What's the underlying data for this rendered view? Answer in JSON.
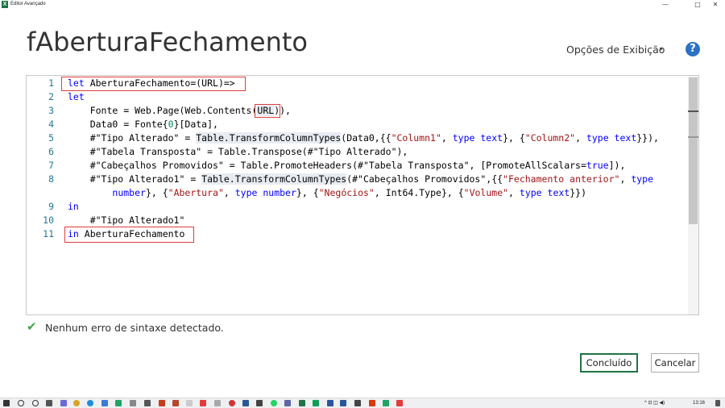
{
  "window": {
    "title": "Editor Avançado",
    "app_icon": "X",
    "controls": {
      "minimize": "—",
      "maximize": "□",
      "close": "✕"
    }
  },
  "query": {
    "name": "fAberturaFechamento"
  },
  "header": {
    "options_label": "Opções de Exibição",
    "options_arrow": "▾",
    "help_icon": "?"
  },
  "editor": {
    "line_numbers": [
      "1",
      "2",
      "3",
      "4",
      "5",
      "6",
      "7",
      "8",
      "",
      "9",
      "10",
      "11"
    ],
    "lines": [
      [
        {
          "t": "let ",
          "c": "kw"
        },
        {
          "t": "AberturaFechamento=(URL)=>",
          "c": ""
        }
      ],
      [
        {
          "t": "let",
          "c": "kw"
        }
      ],
      [
        {
          "t": "    Fonte = Web.Page(Web.Contents(",
          "c": ""
        },
        {
          "t": "URL",
          "c": "ref"
        },
        {
          "t": ")),",
          "c": ""
        }
      ],
      [
        {
          "t": "    Data0 = Fonte{",
          "c": ""
        },
        {
          "t": "0",
          "c": "num"
        },
        {
          "t": "}[Data],",
          "c": ""
        }
      ],
      [
        {
          "t": "    #\"Tipo Alterado\" = ",
          "c": ""
        },
        {
          "t": "Table.TransformColumnTypes",
          "c": "ref"
        },
        {
          "t": "(Data0,{{",
          "c": ""
        },
        {
          "t": "\"Column1\"",
          "c": "str"
        },
        {
          "t": ", ",
          "c": ""
        },
        {
          "t": "type text",
          "c": "kw"
        },
        {
          "t": "}, {",
          "c": ""
        },
        {
          "t": "\"Column2\"",
          "c": "str"
        },
        {
          "t": ", ",
          "c": ""
        },
        {
          "t": "type text",
          "c": "kw"
        },
        {
          "t": "}}),",
          "c": ""
        }
      ],
      [
        {
          "t": "    #\"Tabela Transposta\" = Table.Transpose(#\"Tipo Alterado\"),",
          "c": ""
        }
      ],
      [
        {
          "t": "    #\"Cabeçalhos Promovidos\" = Table.PromoteHeaders(#\"Tabela Transposta\", [PromoteAllScalars=",
          "c": ""
        },
        {
          "t": "true",
          "c": "kw"
        },
        {
          "t": "]),",
          "c": ""
        }
      ],
      [
        {
          "t": "    #\"Tipo Alterado1\" = ",
          "c": ""
        },
        {
          "t": "Table.TransformColumnTypes",
          "c": "ref"
        },
        {
          "t": "(#\"Cabeçalhos Promovidos\",{{",
          "c": ""
        },
        {
          "t": "\"Fechamento anterior\"",
          "c": "str"
        },
        {
          "t": ", ",
          "c": ""
        },
        {
          "t": "type",
          "c": "kw"
        }
      ],
      [
        {
          "t": "        ",
          "c": ""
        },
        {
          "t": "number",
          "c": "kw"
        },
        {
          "t": "}, {",
          "c": ""
        },
        {
          "t": "\"Abertura\"",
          "c": "str"
        },
        {
          "t": ", ",
          "c": ""
        },
        {
          "t": "type number",
          "c": "kw"
        },
        {
          "t": "}, {",
          "c": ""
        },
        {
          "t": "\"Negócios\"",
          "c": "str"
        },
        {
          "t": ", Int64.Type}, {",
          "c": ""
        },
        {
          "t": "\"Volume\"",
          "c": "str"
        },
        {
          "t": ", ",
          "c": ""
        },
        {
          "t": "type text",
          "c": "kw"
        },
        {
          "t": "}})",
          "c": ""
        }
      ],
      [
        {
          "t": "in",
          "c": "kw"
        }
      ],
      [
        {
          "t": "    #\"Tipo Alterado1\"",
          "c": ""
        }
      ],
      [
        {
          "t": "in ",
          "c": "kw"
        },
        {
          "t": "AberturaFechamento",
          "c": ""
        }
      ]
    ]
  },
  "status": {
    "icon": "check-icon",
    "text": "Nenhum erro de sintaxe detectado."
  },
  "buttons": {
    "ok": "Concluído",
    "cancel": "Cancelar"
  },
  "taskbar": {
    "time": "13:16",
    "tray": "^ ⊡ ◫ ◀)"
  },
  "colors": {
    "keyword": "#0000ff",
    "string": "#a31515",
    "number": "#098658",
    "highlight_box": "#e03c3c",
    "help": "#2d72c4",
    "ok_border": "#217346"
  }
}
